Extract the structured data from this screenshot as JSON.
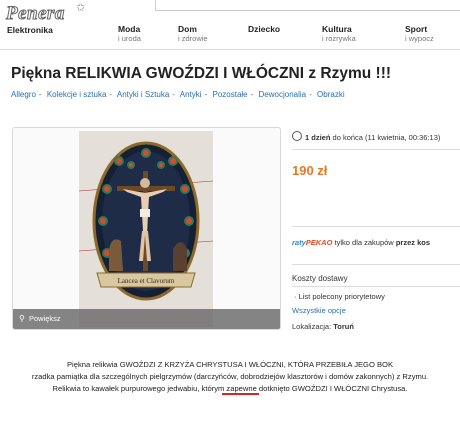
{
  "site": {
    "logo": "Penera"
  },
  "nav": {
    "electronics": "Elektronika",
    "categories": [
      {
        "title": "Moda",
        "sub": "i uroda"
      },
      {
        "title": "Dom",
        "sub": "i zdrowie"
      },
      {
        "title": "Dziecko",
        "sub": ""
      },
      {
        "title": "Kultura",
        "sub": "i rozrywka"
      },
      {
        "title": "Sport",
        "sub": "i wypocz"
      }
    ]
  },
  "listing": {
    "title": "Piękna RELIKWIA GWOŹDZI I WŁÓCZNI z Rzymu !!!",
    "breadcrumb": [
      "Allegro",
      "Kolekcje i sztuka",
      "Antyki i Sztuka",
      "Antyki",
      "Pozostałe",
      "Dewocjonalia",
      "Obrazki"
    ],
    "zoom_label": "Powiększ",
    "time_left_bold": "1 dzień",
    "time_left_rest": " do końca (11 kwietnia, 00:36:13)",
    "price": "190 zł",
    "raty_brand1": "raty",
    "raty_brand2": "PEKAO",
    "raty_text": " tylko dla zakupów ",
    "raty_bold": "przez kos",
    "shipping_title": "Koszty dostawy",
    "shipping_item": "List polecony priorytetowy",
    "shipping_more": "Wszystkie opcje",
    "location_label": "Lokalizacja: ",
    "location_value": "Toruń"
  },
  "description": {
    "line1": "Piękna relikwia GWOŹDZI Z KRZYŻA CHRYSTUSA I WŁÓCZNI, KTÓRA PRZEBIŁA JEGO BOK",
    "line2": "rzadka pamiątka dla szczególnych pielgrzymów (darczyńców, dobrodziejów klasztorów i domów zakonnych) z Rzymu.",
    "line3": "Relikwia to kawałek purpurowego jedwabiu, którym zapewne dotknięto GWOŹDZI I WŁÓCZNI Chrystusa."
  },
  "image_caption": "Lancea et Clavorum",
  "colors": {
    "price": "#e87722",
    "link": "#2a6fb0",
    "highlight": "#d9261c"
  }
}
